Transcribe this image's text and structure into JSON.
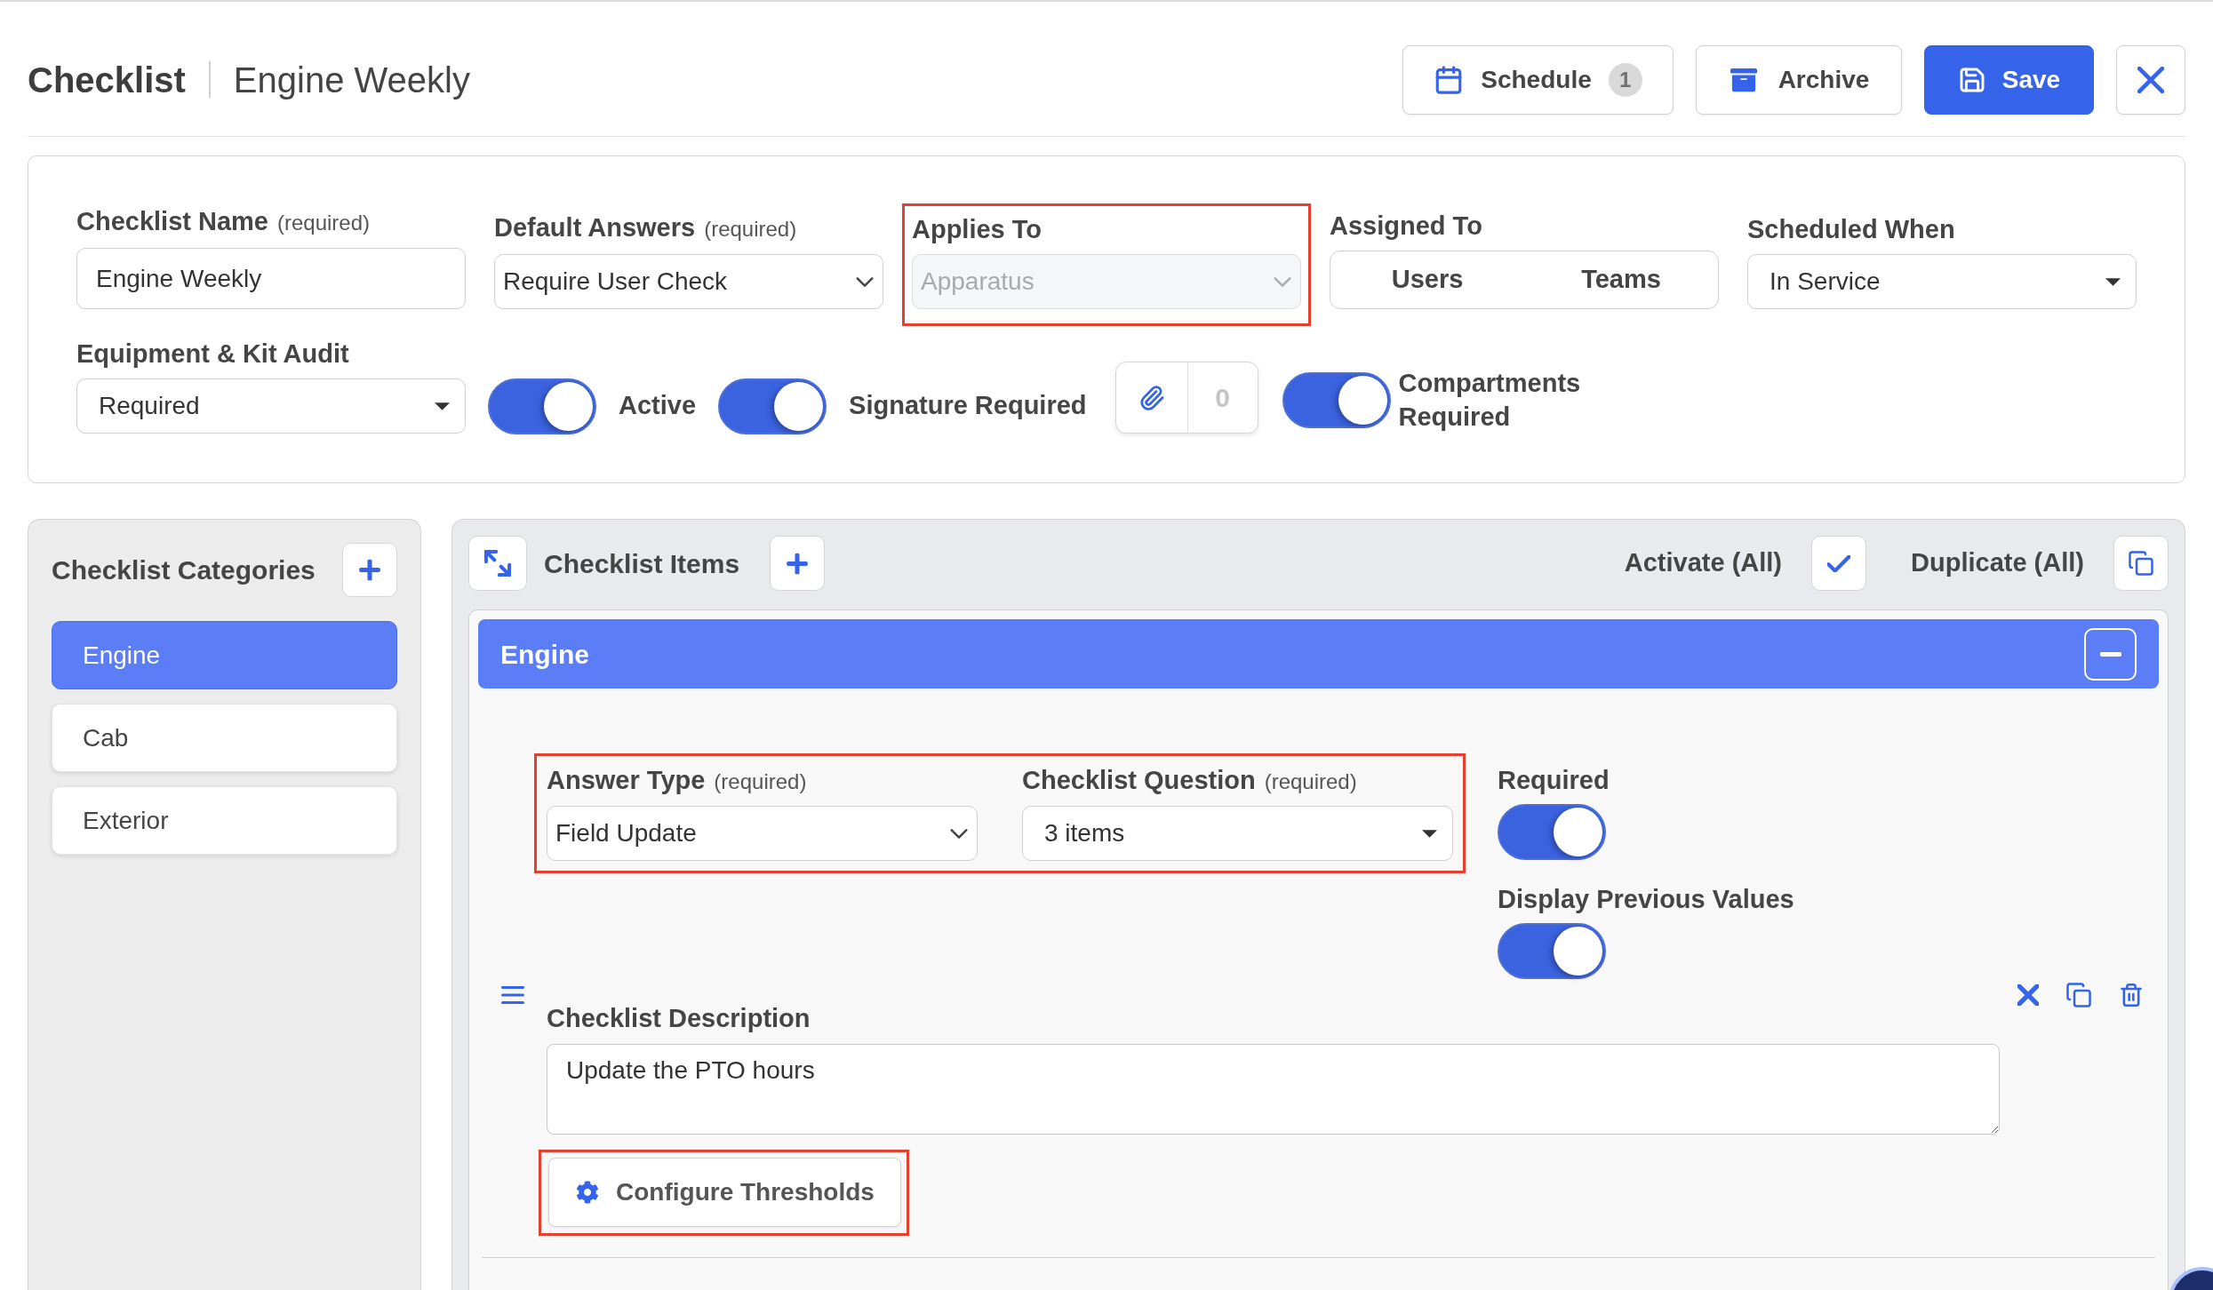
{
  "header": {
    "title": "Checklist",
    "subtitle": "Engine Weekly",
    "actions": [
      {
        "kind": "schedule",
        "label": "Schedule",
        "count": "1"
      },
      {
        "kind": "archive",
        "label": "Archive"
      },
      {
        "kind": "save",
        "label": "Save"
      },
      {
        "kind": "close"
      }
    ]
  },
  "settings": {
    "fields": [
      {
        "kind": "text",
        "label": "Checklist Name",
        "note": "(required)",
        "value": "Engine Weekly",
        "disabled": false,
        "highlighted": false
      },
      {
        "kind": "select",
        "label": "Default Answers",
        "note": "(required)",
        "value": "Require User Check",
        "disabled": false,
        "highlighted": false
      },
      {
        "kind": "select",
        "label": "Applies To",
        "value": "Apparatus",
        "disabled": true,
        "highlighted": true
      },
      {
        "kind": "segmented",
        "label": "Assigned To",
        "options": [
          {
            "label": "Users",
            "selected": false
          },
          {
            "label": "Teams",
            "selected": false
          }
        ],
        "disabled": false,
        "highlighted": false
      },
      {
        "kind": "dropdown",
        "label": "Scheduled When",
        "value": "In Service",
        "disabled": false,
        "highlighted": false
      }
    ],
    "audit": {
      "kind": "dropdown",
      "label": "Equipment & Kit Audit",
      "value": "Required"
    },
    "switches": [
      {
        "label": "Active",
        "on": true
      },
      {
        "label": "Signature Required",
        "on": true
      }
    ],
    "attachments": {
      "count": "0"
    },
    "compartments": {
      "label": "Compartments Required",
      "on": true
    }
  },
  "categories": {
    "title": "Checklist Categories",
    "items": [
      {
        "label": "Engine",
        "selected": true
      },
      {
        "label": "Cab",
        "selected": false
      },
      {
        "label": "Exterior",
        "selected": false
      }
    ]
  },
  "checklist_items": {
    "title": "Checklist Items",
    "bulk_actions": [
      {
        "kind": "activate",
        "label": "Activate (All)"
      },
      {
        "kind": "duplicate",
        "label": "Duplicate (All)"
      }
    ],
    "group": {
      "title": "Engine",
      "expanded": true,
      "items": [
        {
          "highlighted": true,
          "answer_type": {
            "kind": "select",
            "label": "Answer Type",
            "note": "(required)",
            "value": "Field Update"
          },
          "question": {
            "kind": "dropdown",
            "label": "Checklist Question",
            "note": "(required)",
            "value": "3 items"
          },
          "switches": [
            {
              "label": "Required",
              "on": true
            },
            {
              "label": "Display Previous Values",
              "on": true
            }
          ],
          "description": {
            "label": "Checklist Description",
            "value": "Update the PTO hours"
          },
          "thresholds_button": {
            "label": "Configure Thresholds",
            "highlighted": true
          }
        }
      ]
    }
  }
}
